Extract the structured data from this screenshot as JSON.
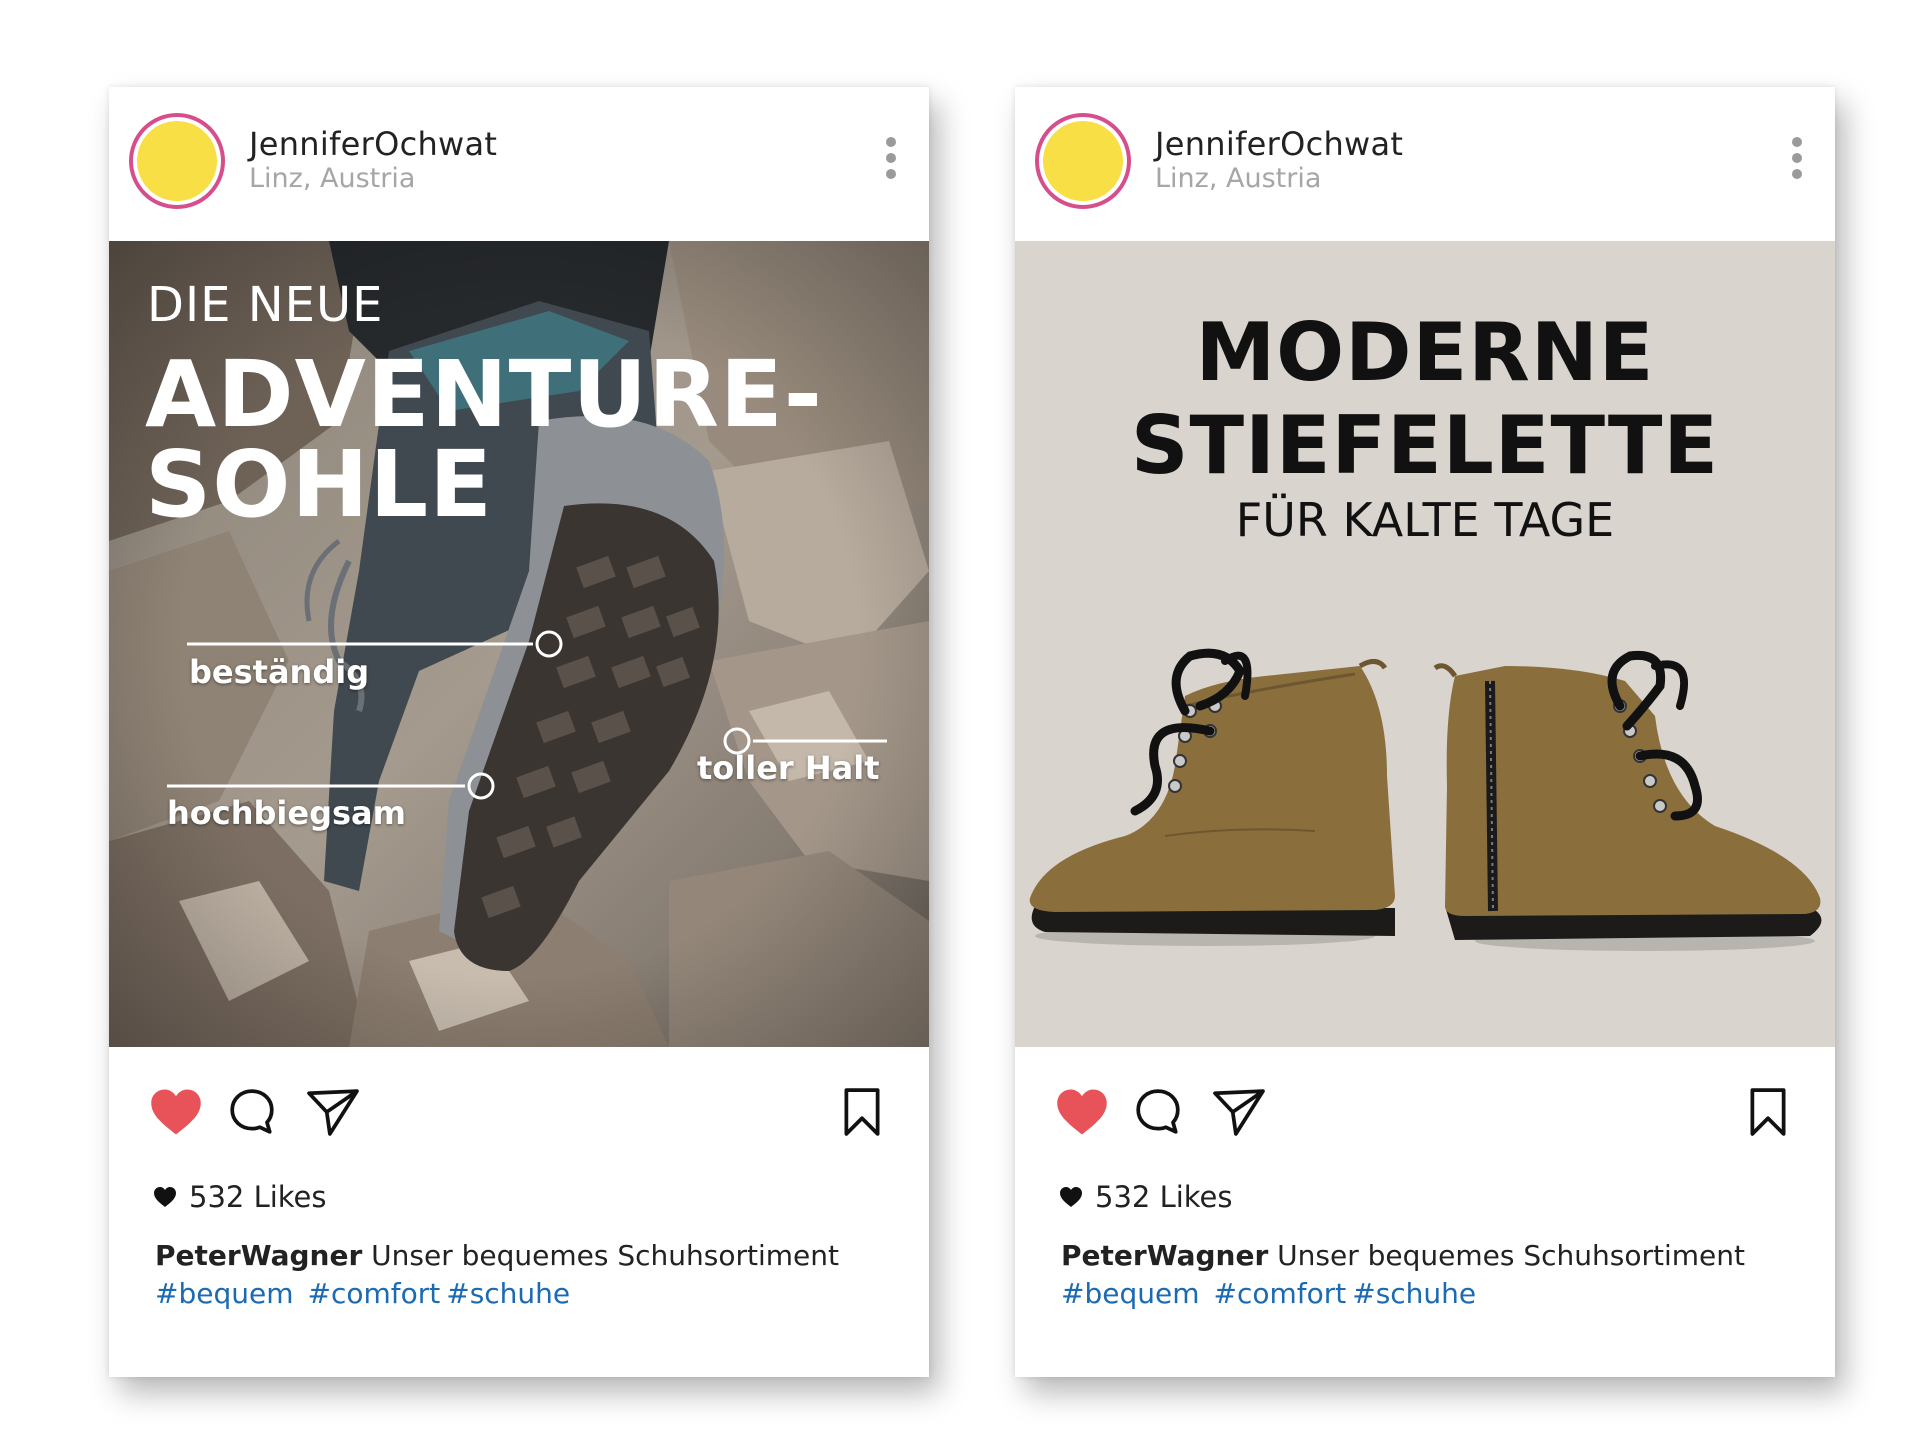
{
  "posts": [
    {
      "username": "JenniferOchwat",
      "location": "Linz, Austria",
      "headline_small": "DIE NEUE",
      "headline_line1": "ADVENTURE-",
      "headline_line2": "SOHLE",
      "features": [
        "beständig",
        "toller Halt",
        "hochbiegsam"
      ],
      "likes": "532 Likes",
      "caption_user": "PeterWagner",
      "caption_text": "Unser bequemes Schuhsortiment",
      "tags": [
        "#bequem",
        "#comfort",
        "#schuhe"
      ]
    },
    {
      "username": "JenniferOchwat",
      "location": "Linz, Austria",
      "title_line1": "MODERNE",
      "title_line2": "STIEFELETTE",
      "subtitle": "FÜR KALTE TAGE",
      "likes": "532 Likes",
      "caption_user": "PeterWagner",
      "caption_text": "Unser bequemes Schuhsortiment",
      "tags": [
        "#bequem",
        "#comfort",
        "#schuhe"
      ]
    }
  ],
  "icons": [
    "more-icon",
    "heart-icon",
    "comment-icon",
    "share-icon",
    "bookmark-icon"
  ],
  "colors": {
    "avatar_fill": "#f7df45",
    "avatar_ring": "#d64f8c",
    "like_red": "#e8535a",
    "hashtag_blue": "#1c6ab1",
    "ad_background": "#d9d4cd"
  }
}
